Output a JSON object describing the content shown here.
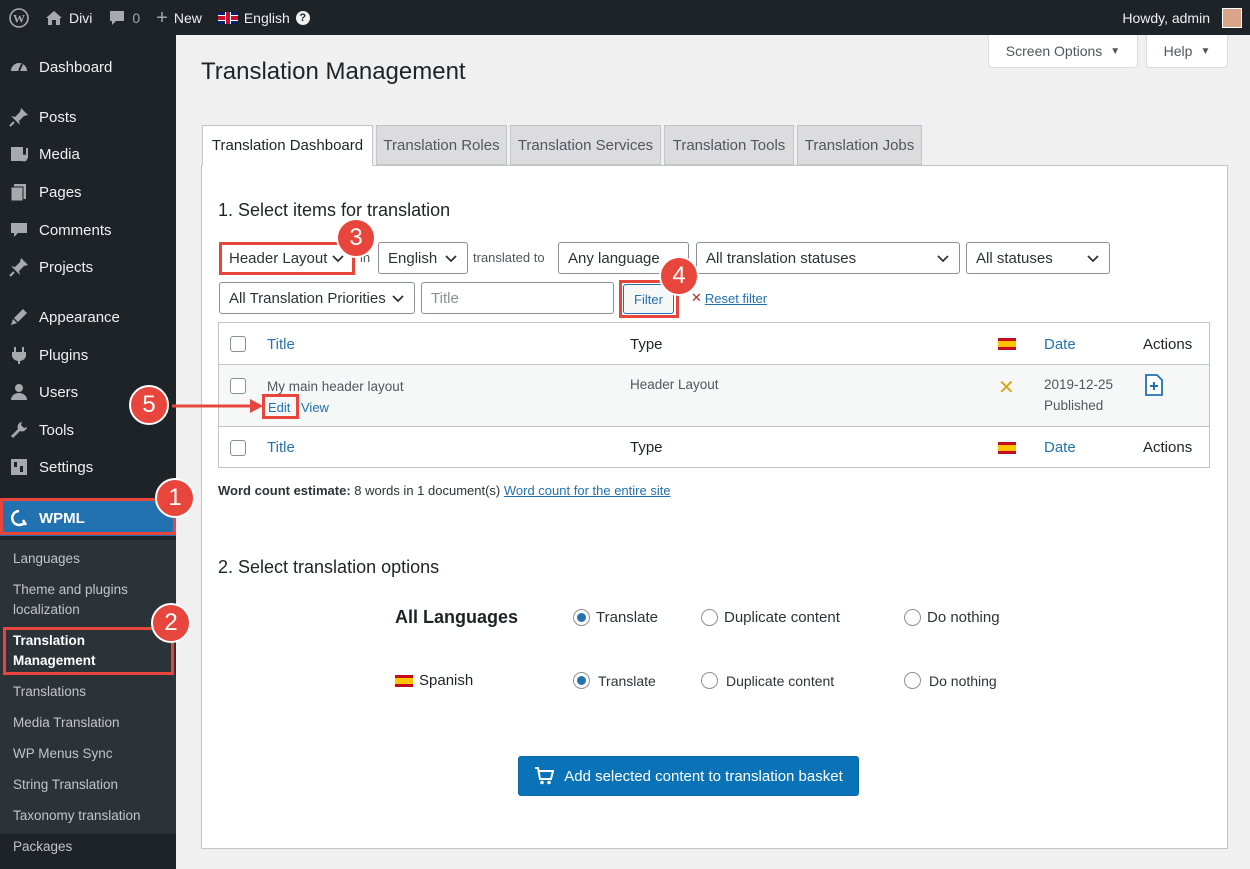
{
  "adminbar": {
    "site_name": "Divi",
    "comments_count": "0",
    "new_label": "New",
    "language": "English",
    "greeting": "Howdy, admin"
  },
  "sidebar": {
    "items": [
      {
        "label": "Dashboard",
        "icon": "dashboard-icon"
      },
      {
        "label": "Posts",
        "icon": "pin-icon"
      },
      {
        "label": "Media",
        "icon": "media-icon"
      },
      {
        "label": "Pages",
        "icon": "pages-icon"
      },
      {
        "label": "Comments",
        "icon": "comment-icon"
      },
      {
        "label": "Projects",
        "icon": "pin-icon"
      },
      {
        "label": "Appearance",
        "icon": "brush-icon"
      },
      {
        "label": "Plugins",
        "icon": "plugin-icon"
      },
      {
        "label": "Users",
        "icon": "user-icon"
      },
      {
        "label": "Tools",
        "icon": "wrench-icon"
      },
      {
        "label": "Settings",
        "icon": "settings-icon"
      },
      {
        "label": "WPML",
        "icon": "wpml-icon"
      }
    ],
    "submenu": [
      "Languages",
      "Theme and plugins localization",
      "Translation Management",
      "Translations",
      "Media Translation",
      "WP Menus Sync",
      "String Translation",
      "Taxonomy translation",
      "Packages"
    ]
  },
  "header": {
    "screen_options": "Screen Options",
    "help": "Help",
    "title": "Translation Management"
  },
  "tabs": [
    "Translation Dashboard",
    "Translation Roles",
    "Translation Services",
    "Translation Tools",
    "Translation Jobs"
  ],
  "section1": {
    "title": "1. Select items for translation",
    "type_select": "Header Layout",
    "in_label": "in",
    "lang_select": "English",
    "translated_to_label": "translated to",
    "target_select": "Any language",
    "status_select": "All translation statuses",
    "all_statuses_select": "All statuses",
    "priority_select": "All Translation Priorities",
    "title_placeholder": "Title",
    "filter_button": "Filter",
    "reset_filter": "Reset filter"
  },
  "table": {
    "columns": {
      "title": "Title",
      "type": "Type",
      "date": "Date",
      "actions": "Actions"
    },
    "rows": [
      {
        "title": "My main header layout",
        "edit": "Edit",
        "view": "View",
        "type": "Header Layout",
        "date": "2019-12-25",
        "status": "Published"
      }
    ]
  },
  "word_count": {
    "label": "Word count estimate:",
    "value": "8 words in 1 document(s)",
    "link": "Word count for the entire site"
  },
  "section2": {
    "title": "2. Select translation options",
    "all_languages": "All Languages",
    "spanish": "Spanish",
    "translate": "Translate",
    "duplicate": "Duplicate content",
    "do_nothing": "Do nothing",
    "add_button": "Add selected content to translation basket"
  },
  "annotations": [
    "1",
    "2",
    "3",
    "4",
    "5"
  ],
  "colors": {
    "accent": "#2271b1",
    "annotation": "#e8453c",
    "sidebar_bg": "#1d2327"
  }
}
